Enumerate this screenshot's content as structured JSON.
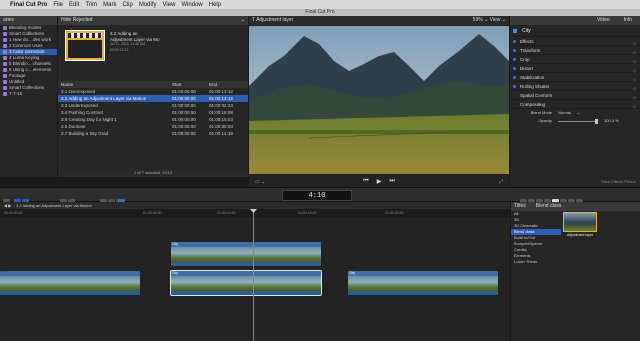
{
  "menubar": {
    "app": "Final Cut Pro",
    "items": [
      "File",
      "Edit",
      "Trim",
      "Mark",
      "Clip",
      "Modify",
      "View",
      "Window",
      "Help"
    ]
  },
  "window_title": "Final Cut Pro",
  "libraries": {
    "header": "aries",
    "items": [
      {
        "label": "Blending modes",
        "indent": false,
        "selected": false
      },
      {
        "label": "Smart Collections",
        "indent": false,
        "selected": false
      },
      {
        "label": "1 How do....des work",
        "indent": false,
        "selected": false
      },
      {
        "label": "2 Common Uses",
        "indent": false,
        "selected": false
      },
      {
        "label": "3 Color correction",
        "indent": false,
        "selected": true
      },
      {
        "label": "4 Luma Keying",
        "indent": false,
        "selected": false
      },
      {
        "label": "5 Blendin....channels",
        "indent": false,
        "selected": false
      },
      {
        "label": "6 Using c....elements",
        "indent": false,
        "selected": false
      },
      {
        "label": "Footage",
        "indent": false,
        "selected": false
      },
      {
        "label": "Untitled",
        "indent": false,
        "selected": false
      },
      {
        "label": "Smart Collections",
        "indent": false,
        "selected": false
      },
      {
        "label": "7-7-15",
        "indent": false,
        "selected": false
      }
    ]
  },
  "browser": {
    "filter": "Hide Rejected",
    "filmstrip": {
      "title_line1": "3.2 Adding an",
      "title_line2": "Adjustment Layer via Mo",
      "date": "Jul 11, 2016, 11:46 AM",
      "duration": "00:00:13:12"
    },
    "columns": [
      "Name",
      "Start",
      "End"
    ],
    "rows": [
      {
        "name": "3.1 Overexposed",
        "start": "01:00:00:00",
        "end": "01:00:13:12",
        "selected": false
      },
      {
        "name": "3.2 Adding an Adjustment Layer via Motion",
        "start": "01:00:00:00",
        "end": "01:00:13:12",
        "selected": true
      },
      {
        "name": "3.3 Underexposed",
        "start": "01:00:00:00",
        "end": "01:00:32:23",
        "selected": false
      },
      {
        "name": "3.4 Pushing Contrast",
        "start": "01:00:00:00",
        "end": "01:00:18:08",
        "selected": false
      },
      {
        "name": "3.5 Creating Day for Night 1",
        "start": "01:00:00:00",
        "end": "01:00:15:03",
        "selected": false
      },
      {
        "name": "3.6 Duotone",
        "start": "01:00:00:00",
        "end": "01:00:30:03",
        "selected": false
      },
      {
        "name": "3.7 Building a Sky Grad",
        "start": "01:00:00:00",
        "end": "01:00:14:19",
        "selected": false
      }
    ],
    "status": "1 of 7 selected, 13:12"
  },
  "viewer": {
    "title": "Adjustment layer",
    "zoom": "59%",
    "view_label": "View"
  },
  "inspector": {
    "tabs": [
      "Video",
      "Info"
    ],
    "clip_name": "City",
    "sections": [
      {
        "label": "Effects",
        "has_dot": true
      },
      {
        "label": "Transform",
        "has_dot": true
      },
      {
        "label": "Crop",
        "has_dot": true
      },
      {
        "label": "Distort",
        "has_dot": true
      },
      {
        "label": "Stabilization",
        "has_dot": true
      },
      {
        "label": "Rolling Shutter",
        "has_dot": true
      },
      {
        "label": "Spatial Conform",
        "has_dot": false
      },
      {
        "label": "Compositing",
        "has_dot": false
      }
    ],
    "blend_mode_label": "Blend Mode",
    "blend_mode_value": "Normal",
    "opacity_label": "Opacity",
    "opacity_value": "100.0 %",
    "save_preset": "Save Effects Preset"
  },
  "timeline": {
    "timecode": "4:10",
    "project_title": "3.2 Adding an Adjustment Layer via Motion",
    "ruler": [
      "00:00:00:00",
      "01:00:05:00",
      "01:00:10:00",
      "01:00:15:00",
      "01:00:20:00"
    ],
    "clips": [
      {
        "label": "City",
        "lane": "upper"
      },
      {
        "label": "City",
        "lane": "lower"
      },
      {
        "label": "City",
        "lane": "lower"
      },
      {
        "label": "City",
        "lane": "lower"
      }
    ]
  },
  "effects_browser": {
    "header_left": "Titles",
    "header_right": "Blend class",
    "categories": [
      {
        "label": "All",
        "selected": false
      },
      {
        "label": "3D",
        "selected": false
      },
      {
        "label": "3D Cinematic",
        "selected": false
      },
      {
        "label": "Blend class",
        "selected": true
      },
      {
        "label": "Build In/Out",
        "selected": false
      },
      {
        "label": "Bumper/Opener",
        "selected": false
      },
      {
        "label": "Credits",
        "selected": false
      },
      {
        "label": "Elements",
        "selected": false
      },
      {
        "label": "Lower Thirds",
        "selected": false
      }
    ],
    "item_label": "Adjustment layer"
  },
  "colors": {
    "selection": "#2d5eb5",
    "clip_blue": "#2a5e96",
    "clip_label_blue": "#3d6fa8",
    "playhead": "#888888"
  }
}
